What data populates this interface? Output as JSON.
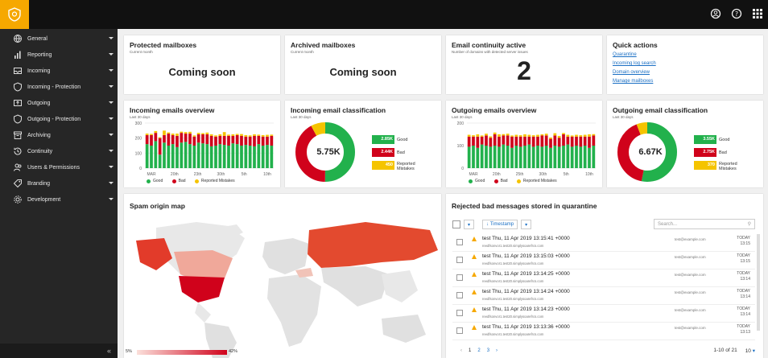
{
  "sidebar": {
    "items": [
      {
        "label": "General",
        "icon": "globe-icon"
      },
      {
        "label": "Reporting",
        "icon": "bar-chart-icon"
      },
      {
        "label": "Incoming",
        "icon": "inbox-icon"
      },
      {
        "label": "Incoming - Protection",
        "icon": "shield-icon"
      },
      {
        "label": "Outgoing",
        "icon": "outbox-icon"
      },
      {
        "label": "Outgoing - Protection",
        "icon": "shield-icon"
      },
      {
        "label": "Archiving",
        "icon": "archive-icon"
      },
      {
        "label": "Continuity",
        "icon": "history-icon"
      },
      {
        "label": "Users & Permissions",
        "icon": "users-icon"
      },
      {
        "label": "Branding",
        "icon": "tag-icon"
      },
      {
        "label": "Development",
        "icon": "gear-icon"
      }
    ],
    "collapse": "«"
  },
  "cards": {
    "protected": {
      "title": "Protected mailboxes",
      "sub": "Current month",
      "value": "Coming soon"
    },
    "archived": {
      "title": "Archived mailboxes",
      "sub": "Current month",
      "value": "Coming soon"
    },
    "continuity": {
      "title": "Email continuity active",
      "sub": "Number of domains with detected server issues",
      "value": "2"
    },
    "quick": {
      "title": "Quick actions",
      "links": [
        "Quarantine",
        "Incoming log search",
        "Domain overview",
        "Manage mailboxes"
      ]
    },
    "in_overview": {
      "title": "Incoming emails overview",
      "sub": "Last 30 days"
    },
    "in_class": {
      "title": "Incoming email classification",
      "sub": "Last 30 days"
    },
    "out_overview": {
      "title": "Outgoing emails overview",
      "sub": "Last 30 days"
    },
    "out_class": {
      "title": "Outgoing email classification",
      "sub": "Last 30 days"
    },
    "spam": {
      "title": "Spam origin map",
      "min": "5%",
      "max": "42%"
    },
    "quarantine": {
      "title": "Rejected bad messages stored in quarantine"
    }
  },
  "legend": {
    "good": "Good",
    "bad": "Bad",
    "reported": "Reported Mistakes"
  },
  "classification": {
    "incoming": {
      "total": "5.75K",
      "good": "2.85K",
      "bad": "2.44K",
      "reported": "450",
      "good_frac": 0.5,
      "bad_frac": 0.42,
      "rep_frac": 0.08
    },
    "outgoing": {
      "total": "6.67K",
      "good": "3.55K",
      "bad": "2.75K",
      "reported": "370",
      "good_frac": 0.53,
      "bad_frac": 0.41,
      "rep_frac": 0.06
    },
    "labels": {
      "good": "Good",
      "bad": "Bad",
      "reported": "Reported Mistakes"
    }
  },
  "colors": {
    "good": "#22b14c",
    "bad": "#d0021b",
    "reported": "#f5c400",
    "accent": "#f6a800",
    "link": "#1a6fc4"
  },
  "quarantine": {
    "timestamp_btn": "Timestamp",
    "search_placeholder": "Search...",
    "rows": [
      {
        "subject": "test Thu, 11 Apr 2019 13:15:41 +0000",
        "from": "reedfsonvor1.test20.simplysoarefrcs.com",
        "to": "test@example.com",
        "day": "TODAY",
        "time": "13:15"
      },
      {
        "subject": "test Thu, 11 Apr 2019 13:15:03 +0000",
        "from": "reedfsonvor1.test20.simplysoarefrcs.com",
        "to": "test@example.com",
        "day": "TODAY",
        "time": "13:15"
      },
      {
        "subject": "test Thu, 11 Apr 2019 13:14:25 +0000",
        "from": "reedfsonvor1.test20.simplysoarefrcs.com",
        "to": "test@example.com",
        "day": "TODAY",
        "time": "13:14"
      },
      {
        "subject": "test Thu, 11 Apr 2019 13:14:24 +0000",
        "from": "reedfsonvor1.test20.simplysoarefrcs.com",
        "to": "test@example.com",
        "day": "TODAY",
        "time": "13:14"
      },
      {
        "subject": "test Thu, 11 Apr 2019 13:14:23 +0000",
        "from": "reedfsonvor1.test20.simplysoarefrcs.com",
        "to": "test@example.com",
        "day": "TODAY",
        "time": "13:14"
      },
      {
        "subject": "test Thu, 11 Apr 2019 13:13:36 +0000",
        "from": "reedfsonvor1.test20.simplysoarefrcs.com",
        "to": "test@example.com",
        "day": "TODAY",
        "time": "13:13"
      }
    ],
    "pages": [
      "1",
      "2",
      "3"
    ],
    "prev": "‹",
    "next": "›",
    "range": "1-10 of 21",
    "per_page": "10"
  },
  "chart_data": [
    {
      "type": "bar",
      "title": "Incoming emails overview",
      "ylim": [
        0,
        300
      ],
      "yticks": [
        "300",
        "200",
        "100",
        "0"
      ],
      "xticks": [
        "MAR",
        "20th",
        "23th",
        "30th",
        "5th",
        "10th"
      ],
      "series": [
        {
          "name": "Good",
          "values": [
            160,
            150,
            180,
            90,
            170,
            150,
            160,
            140,
            170,
            175,
            160,
            150,
            170,
            165,
            160,
            145,
            150,
            160,
            155,
            150,
            165,
            160,
            150,
            155,
            150,
            145,
            160,
            150,
            155,
            150
          ]
        },
        {
          "name": "Bad",
          "values": [
            60,
            70,
            55,
            110,
            50,
            80,
            60,
            75,
            65,
            55,
            70,
            60,
            55,
            60,
            65,
            70,
            60,
            55,
            60,
            65,
            50,
            60,
            65,
            55,
            60,
            70,
            55,
            60,
            55,
            65
          ]
        },
        {
          "name": "Reported Mistakes",
          "values": [
            10,
            8,
            12,
            6,
            30,
            8,
            10,
            15,
            8,
            10,
            12,
            8,
            10,
            8,
            12,
            10,
            8,
            10,
            25,
            8,
            10,
            8,
            12,
            10,
            8,
            10,
            8,
            10,
            12,
            8
          ]
        }
      ]
    },
    {
      "type": "bar",
      "title": "Outgoing emails overview",
      "ylim": [
        0,
        200
      ],
      "yticks": [
        "200",
        "100",
        "0"
      ],
      "xticks": [
        "MAR",
        "20th",
        "25th",
        "30th",
        "5th",
        "10th"
      ],
      "series": [
        {
          "name": "Good",
          "values": [
            95,
            100,
            90,
            105,
            100,
            95,
            100,
            95,
            105,
            100,
            90,
            100,
            95,
            100,
            105,
            95,
            100,
            95,
            100,
            90,
            100,
            95,
            100,
            105,
            95,
            100,
            95,
            100,
            90,
            100
          ]
        },
        {
          "name": "Bad",
          "values": [
            45,
            40,
            50,
            35,
            45,
            40,
            50,
            45,
            40,
            45,
            50,
            40,
            45,
            40,
            35,
            45,
            40,
            50,
            45,
            40,
            45,
            40,
            50,
            35,
            45,
            40,
            45,
            40,
            50,
            45
          ]
        },
        {
          "name": "Reported Mistakes",
          "values": [
            8,
            6,
            10,
            5,
            8,
            6,
            8,
            10,
            6,
            8,
            5,
            8,
            6,
            10,
            8,
            6,
            8,
            5,
            8,
            6,
            10,
            8,
            6,
            8,
            5,
            8,
            6,
            8,
            10,
            6
          ]
        }
      ]
    }
  ]
}
